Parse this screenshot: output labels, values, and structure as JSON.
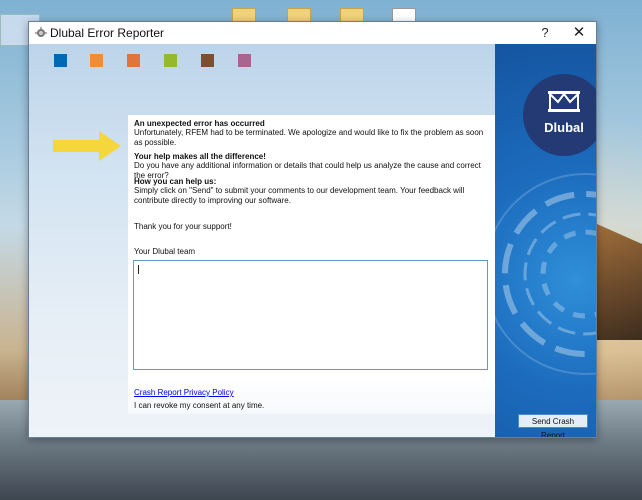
{
  "window": {
    "title": "Dlubal Error Reporter",
    "help_glyph": "?",
    "close_glyph": "✕"
  },
  "header": {
    "swatch_colors": [
      "#0069b4",
      "#f28c32",
      "#e0743a",
      "#95b92a",
      "#7c4f33",
      "#a7658f"
    ]
  },
  "message": {
    "heading1": "An unexpected error has occurred",
    "para1": "Unfortunately, RFEM had to be terminated. We apologize and would like to fix the problem as soon as possible.",
    "heading2": "Your help makes all the difference!",
    "para2": "Do you have any additional information or details that could help us analyze the cause and correct the error?",
    "heading3": "How you can help us:",
    "para3": "Simply click on \"Send\" to submit your comments to our development team. Your feedback will contribute directly to improving our software.",
    "thanks": "Thank you for your support!",
    "signoff": "Your Dlubal team"
  },
  "comment": {
    "value": ""
  },
  "footer": {
    "privacy_link": "Crash Report Privacy Policy",
    "consent": "I can revoke my consent at any time.",
    "send_button": "Send Crash Report"
  },
  "branding": {
    "logo_text": "Dlubal",
    "arrow_color": "#f5d63d"
  }
}
